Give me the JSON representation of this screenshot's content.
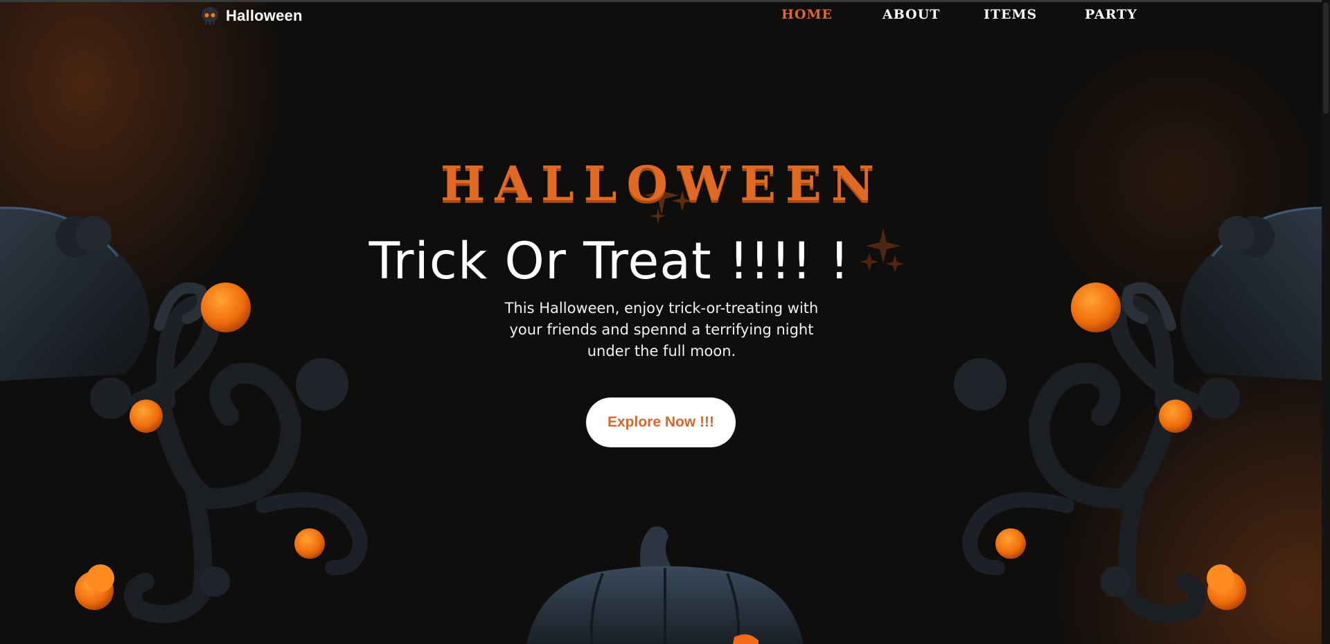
{
  "brand": {
    "name": "Halloween",
    "icon": "skull-icon"
  },
  "nav": {
    "items": [
      {
        "label": "HOME",
        "active": true
      },
      {
        "label": "ABOUT",
        "active": false
      },
      {
        "label": "ITEMS",
        "active": false
      },
      {
        "label": "PARTY",
        "active": false
      }
    ]
  },
  "hero": {
    "title": "HALLOWEEN",
    "subtitle": "Trick Or Treat !!!! !",
    "description": "This Halloween, enjoy trick-or-treating with your friends and spennd a terrifying night under the full moon.",
    "cta_label": "Explore Now !!!"
  },
  "colors": {
    "accent": "#e06a23",
    "background": "#0f0e0d",
    "orb": "#ff7a12",
    "branch": "#22262b"
  },
  "decorations": [
    "sparkle-icon",
    "spooky-branch-left",
    "spooky-branch-right",
    "pumpkin"
  ]
}
